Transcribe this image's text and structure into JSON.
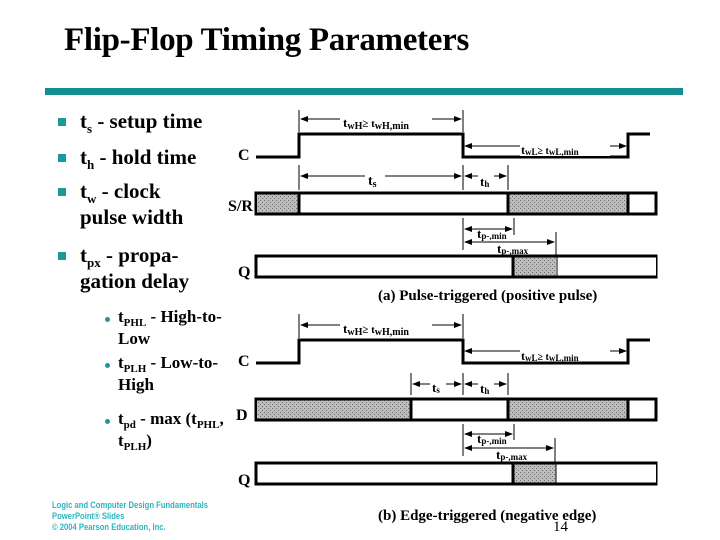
{
  "slide": {
    "title": "Flip-Flop Timing Parameters",
    "page_number": "14",
    "accent_color": "#138f8f",
    "bullet_color": "#1a9a9a"
  },
  "bullets": [
    {
      "main": "t",
      "sub": "s",
      "rest": " - setup time"
    },
    {
      "main": "t",
      "sub": "h",
      "rest": " - hold time"
    },
    {
      "main": "t",
      "sub": "w",
      "rest": " - clock",
      "line2": "pulse width"
    },
    {
      "main": "t",
      "sub": "px",
      "rest": " - propa-",
      "line2": "gation delay"
    }
  ],
  "sub_bullets": [
    {
      "main": "t",
      "sub": "PHL",
      "rest": " - High-to-",
      "line2": "Low"
    },
    {
      "main": "t",
      "sub": "PLH",
      "rest": " - Low-to-",
      "line2": "High"
    },
    {
      "main": "t",
      "sub": "pd",
      "rest": " - max (t",
      "sub2": "PHL",
      "rest2": ",",
      "line2_main": "t",
      "line2_sub": "PLH",
      "line2_rest": ")"
    }
  ],
  "diagram_a": {
    "signals": {
      "clock": "C",
      "input": "S/R",
      "output": "Q"
    },
    "labels": {
      "twh": "tWH ≥ tWH,min",
      "twh_main": "t",
      "twh_sub": "wH",
      "twh_rel": "≥ t",
      "twh_sub2": "wH,min",
      "twl_main": "t",
      "twl_sub": "wL",
      "twl_rel": "≥ t",
      "twl_sub2": "wL,min",
      "ts_main": "t",
      "ts_sub": "s",
      "th_main": "t",
      "th_sub": "h",
      "tpmin_main": "t",
      "tpmin_sub": "p-,min",
      "tpmax_main": "t",
      "tpmax_sub": "p-,max"
    },
    "caption": "(a) Pulse-triggered (positive pulse)"
  },
  "diagram_b": {
    "signals": {
      "clock": "C",
      "input": "D",
      "output": "Q"
    },
    "labels": {
      "twh_main": "t",
      "twh_sub": "wH",
      "twh_rel": "≥ t",
      "twh_sub2": "wH,min",
      "twl_main": "t",
      "twl_sub": "wL",
      "twl_rel": "≥ t",
      "twl_sub2": "wL,min",
      "ts_main": "t",
      "ts_sub": "s",
      "th_main": "t",
      "th_sub": "h",
      "tpmin_main": "t",
      "tpmin_sub": "p-,min",
      "tpmax_main": "t",
      "tpmax_sub": "p-,max"
    },
    "caption": "(b) Edge-triggered (negative edge)"
  },
  "footer": {
    "line1": "Logic and Computer Design Fundamentals",
    "line2": "PowerPoint® Slides",
    "line3": "© 2004 Pearson Education, Inc."
  }
}
